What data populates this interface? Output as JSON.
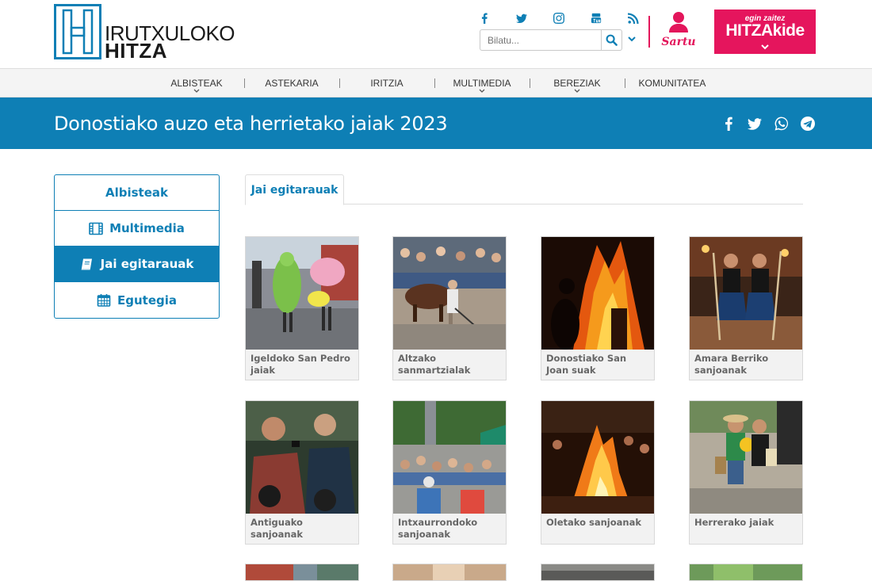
{
  "site": {
    "logo_top": "IRUTXULOKO",
    "logo_bottom": "HITZA"
  },
  "header": {
    "social_icons": [
      "facebook-icon",
      "twitter-icon",
      "instagram-icon",
      "youtube-icon",
      "rss-icon"
    ],
    "search_placeholder": "Bilatu...",
    "login_label": "Sartu",
    "promo_top": "egin zaitez",
    "promo_main": "HITZAkide",
    "accent": "#e3165b"
  },
  "nav": {
    "items": [
      {
        "label": "ALBISTEAK",
        "has_dropdown": true
      },
      {
        "label": "ASTEKARIA",
        "has_dropdown": false
      },
      {
        "label": "IRITZIA",
        "has_dropdown": false
      },
      {
        "label": "MULTIMEDIA",
        "has_dropdown": true
      },
      {
        "label": "BEREZIAK",
        "has_dropdown": true
      },
      {
        "label": "KOMUNITATEA",
        "has_dropdown": false
      }
    ]
  },
  "band": {
    "title": "Donostiako auzo eta herrietako jaiak 2023",
    "share_icons": [
      "facebook-icon",
      "twitter-icon",
      "whatsapp-icon",
      "telegram-icon"
    ],
    "color": "#0e7fb5"
  },
  "sidebar": {
    "items": [
      {
        "label": "Albisteak",
        "icon": "",
        "active": false
      },
      {
        "label": "Multimedia",
        "icon": "film-icon",
        "active": false
      },
      {
        "label": "Jai egitarauak",
        "icon": "book-icon",
        "active": true
      },
      {
        "label": "Egutegia",
        "icon": "calendar-icon",
        "active": false
      }
    ]
  },
  "tabs": {
    "active": "Jai egitarauak"
  },
  "cards": [
    {
      "label": "Igeldoko San Pedro jaiak"
    },
    {
      "label": "Altzako sanmartzialak"
    },
    {
      "label": "Donostiako San Joan suak"
    },
    {
      "label": "Amara Berriko sanjoanak"
    },
    {
      "label": "Antiguako sanjoanak"
    },
    {
      "label": "Intxaurrondoko sanjoanak"
    },
    {
      "label": "Oletako sanjoanak"
    },
    {
      "label": "Herrerako jaiak"
    }
  ]
}
